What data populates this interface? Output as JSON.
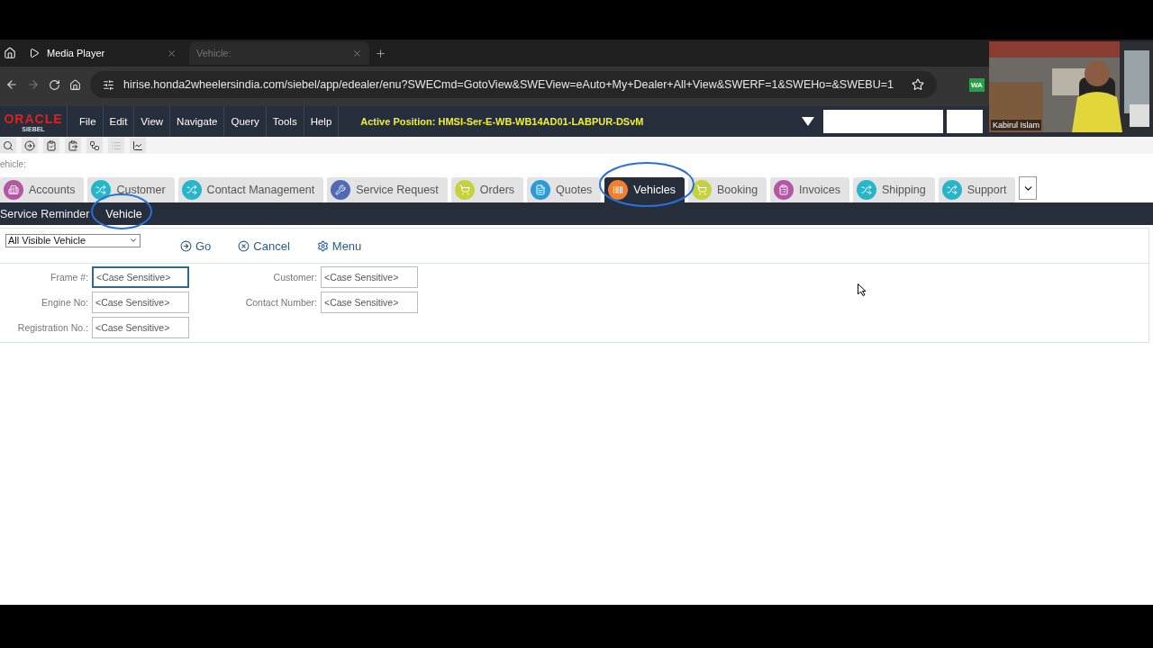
{
  "browser": {
    "tabs": [
      {
        "title": "Media Player",
        "selected": true
      },
      {
        "title": "Vehicle:",
        "selected": false
      }
    ],
    "address": "hirise.honda2wheelersindia.com/siebel/app/edealer/enu?SWECmd=GotoView&SWEView=eAuto+My+Dealer+All+View&SWERF=1&SWEHo=&SWEBU=1",
    "extension_badge": "WA"
  },
  "app_header": {
    "logo": "ORACLE",
    "logo_sub": "SIEBEL",
    "menu": [
      "File",
      "Edit",
      "View",
      "Navigate",
      "Query",
      "Tools",
      "Help"
    ],
    "active_position": "Active Position: HMSI-Ser-E-WB-WB14AD01-LABPUR-DSvM"
  },
  "toolbar": [
    {
      "disabled": false
    },
    {
      "disabled": false
    },
    {
      "disabled": false
    },
    {
      "disabled": false
    },
    {
      "disabled": false
    },
    {
      "disabled": true
    },
    {
      "disabled": false
    }
  ],
  "breadcrumb": "ehicle:",
  "screen_tabs": [
    {
      "label": "Accounts",
      "color": "#b455a6",
      "selected": false
    },
    {
      "label": "Customer",
      "color": "#26b5c9",
      "selected": false
    },
    {
      "label": "Contact Management",
      "color": "#26b5c9",
      "selected": false
    },
    {
      "label": "Service Request",
      "color": "#4f6bb5",
      "selected": false
    },
    {
      "label": "Orders",
      "color": "#c5d23c",
      "selected": false
    },
    {
      "label": "Quotes",
      "color": "#2e9bd6",
      "selected": false
    },
    {
      "label": "Vehicles",
      "color": "#f08030",
      "selected": true
    },
    {
      "label": "Booking",
      "color": "#c5d23c",
      "selected": false
    },
    {
      "label": "Invoices",
      "color": "#b455a6",
      "selected": false
    },
    {
      "label": "Shipping",
      "color": "#26b5c9",
      "selected": false
    },
    {
      "label": "Support",
      "color": "#26b5c9",
      "selected": false
    }
  ],
  "view_tabs": [
    {
      "label": "Service Reminder",
      "selected": false
    },
    {
      "label": "Vehicle",
      "selected": true
    }
  ],
  "query_form": {
    "view_select": "All Visible Vehicle",
    "actions": [
      "Go",
      "Cancel",
      "Menu"
    ],
    "columns": [
      [
        {
          "label": "Frame #:",
          "placeholder": "<Case Sensitive>",
          "focused": true
        },
        {
          "label": "Engine No:",
          "placeholder": "<Case Sensitive>",
          "focused": false
        },
        {
          "label": "Registration No.:",
          "placeholder": "<Case Sensitive>",
          "focused": false
        }
      ],
      [
        {
          "label": "Customer:",
          "placeholder": "<Case Sensitive>",
          "focused": false
        },
        {
          "label": "Contact Number:",
          "placeholder": "<Case Sensitive>",
          "focused": false
        }
      ]
    ]
  },
  "webcam": {
    "kind": "picture",
    "name": "Kabirul Islam"
  }
}
